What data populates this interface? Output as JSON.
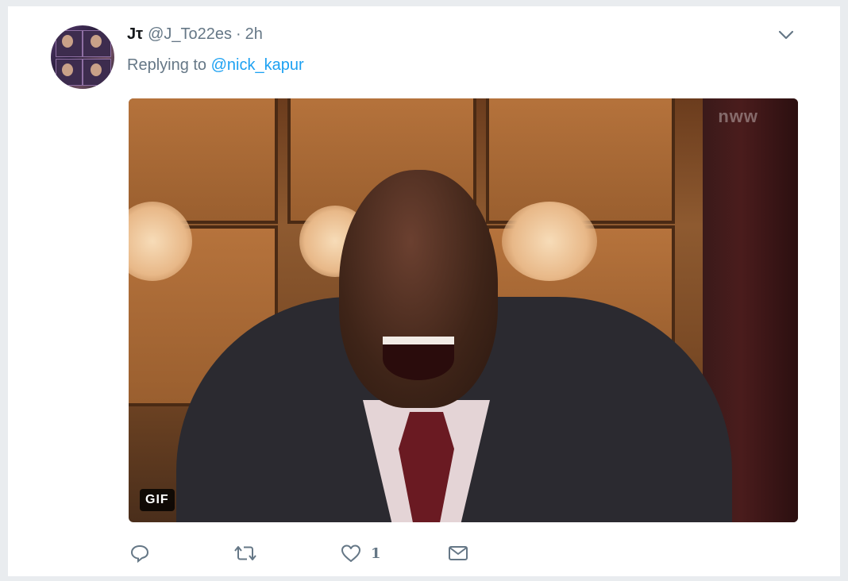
{
  "tweet": {
    "display_name": "Jτ",
    "handle": "@J_To22es",
    "separator": "·",
    "time": "2h",
    "replying_prefix": "Replying to",
    "replying_mention": "@nick_kapur",
    "media": {
      "badge": "GIF",
      "watermark": "nww"
    },
    "actions": {
      "reply_icon": "reply-icon",
      "retweet_icon": "retweet-icon",
      "like_icon": "heart-icon",
      "like_count": "1",
      "dm_icon": "envelope-icon"
    },
    "menu_icon": "chevron-down-icon"
  },
  "colors": {
    "link": "#1da1f2",
    "secondary_text": "#657786",
    "primary_text": "#14171a",
    "background": "#e9ecef",
    "card": "#ffffff"
  }
}
